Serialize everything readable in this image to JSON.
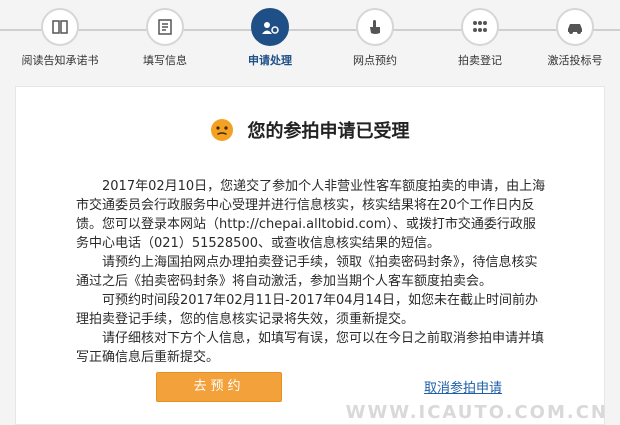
{
  "steps": [
    {
      "label": "阅读告知承诺书",
      "icon": "book-icon"
    },
    {
      "label": "填写信息",
      "icon": "form-icon"
    },
    {
      "label": "申请处理",
      "icon": "process-icon",
      "active": true
    },
    {
      "label": "网点预约",
      "icon": "hand-pointer-icon"
    },
    {
      "label": "拍卖登记",
      "icon": "dots-icon"
    },
    {
      "label": "激活投标号",
      "icon": "car-icon"
    }
  ],
  "main": {
    "title": "您的参拍申请已受理",
    "paragraphs": [
      "2017年02月10日，您递交了参加个人非营业性客车额度拍卖的申请，由上海市交通委员会行政服务中心受理并进行信息核实，核实结果将在20个工作日内反馈。您可以登录本网站（http://chepai.alltobid.com）、或拨打市交通委行政服务中心电话（021）51528500、或查收信息核实结果的短信。",
      "请预约上海国拍网点办理拍卖登记手续，领取《拍卖密码封条》，待信息核实通过之后《拍卖密码封条》将自动激活，参加当期个人客车额度拍卖会。",
      "可预约时间段2017年02月11日-2017年04月14日，如您未在截止时间前办理拍卖登记手续，您的信息核实记录将失效，须重新提交。",
      "请仔细核对下方个人信息，如填写有误，您可以在今日之前取消参拍申请并填写正确信息后重新提交。"
    ],
    "reserve_button": "去预约",
    "cancel_link": "取消参拍申请"
  },
  "watermark": "WWW.ICAUTO.COM.CN",
  "colors": {
    "accent": "#1f4f87",
    "button": "#f2a13b",
    "link": "#1f5fa8"
  }
}
